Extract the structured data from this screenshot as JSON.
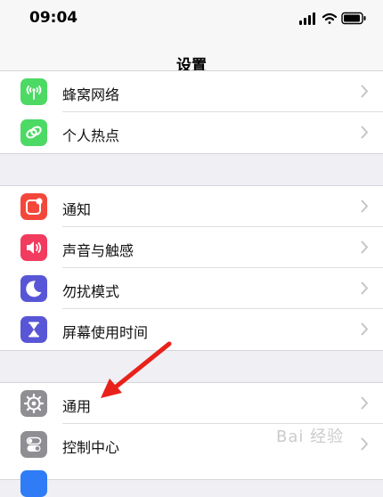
{
  "status_bar": {
    "time": "09:04"
  },
  "nav": {
    "title": "设置"
  },
  "group1": [
    {
      "label": "蜂窝网络",
      "icon": "cellular-icon",
      "color": "#4cd964"
    },
    {
      "label": "个人热点",
      "icon": "hotspot-icon",
      "color": "#4cd964"
    }
  ],
  "group2": [
    {
      "label": "通知",
      "icon": "notification-icon",
      "color": "#f4473b"
    },
    {
      "label": "声音与触感",
      "icon": "sound-icon",
      "color": "#f23b5e"
    },
    {
      "label": "勿扰模式",
      "icon": "moon-icon",
      "color": "#5856d6"
    },
    {
      "label": "屏幕使用时间",
      "icon": "hourglass-icon",
      "color": "#5856d6"
    }
  ],
  "group3": [
    {
      "label": "通用",
      "icon": "gear-icon",
      "color": "#8e8e93"
    },
    {
      "label": "控制中心",
      "icon": "toggles-icon",
      "color": "#8e8e93"
    }
  ],
  "watermark": "Bai 经验",
  "colors": {
    "annotation_arrow": "#e8221b"
  }
}
